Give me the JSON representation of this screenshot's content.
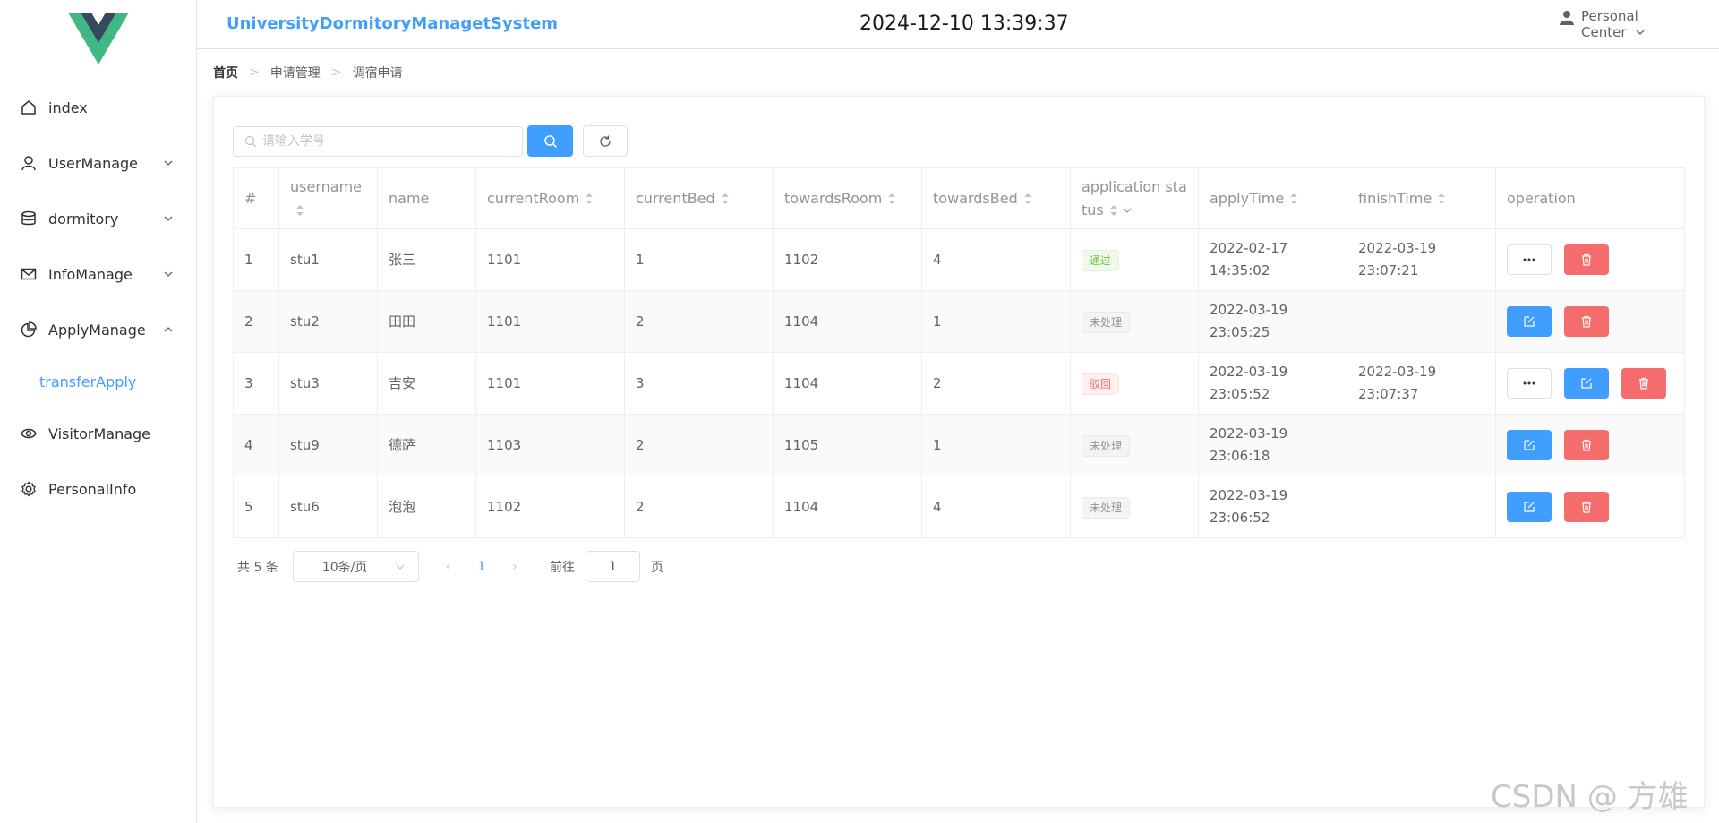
{
  "colors": {
    "accent": "#409eff",
    "danger": "#f56c6c",
    "success": "#67c23a",
    "logo_outer": "#41b883",
    "logo_inner": "#35495e"
  },
  "sidebar": {
    "logo_icon": "vue-logo",
    "items": [
      {
        "label": "index",
        "icon": "home-icon"
      },
      {
        "label": "UserManage",
        "icon": "user-icon",
        "chevron": "down"
      },
      {
        "label": "dormitory",
        "icon": "database-icon",
        "chevron": "down"
      },
      {
        "label": "InfoManage",
        "icon": "mail-icon",
        "chevron": "down"
      },
      {
        "label": "ApplyManage",
        "icon": "pie-chart-icon",
        "chevron": "up"
      },
      {
        "label": "transferApply",
        "sub": true,
        "active": true
      },
      {
        "label": "VisitorManage",
        "icon": "eye-icon"
      },
      {
        "label": "PersonalInfo",
        "icon": "gear-icon"
      }
    ]
  },
  "header": {
    "title": "UniversityDormitoryManagetSystem",
    "datetime": "2024-12-10 13:39:37",
    "user_line1": "Personal",
    "user_line2": "Center"
  },
  "breadcrumb": [
    "首页",
    "申请管理",
    "调宿申请"
  ],
  "search": {
    "placeholder": "请输入学号",
    "value": ""
  },
  "table": {
    "columns": [
      "#",
      "username",
      "name",
      "currentRoom",
      "currentBed",
      "towardsRoom",
      "towardsBed",
      "application status",
      "applyTime",
      "finishTime",
      "operation"
    ],
    "rows": [
      {
        "idx": "1",
        "username": "stu1",
        "name": "张三",
        "currentRoom": "1101",
        "currentBed": "1",
        "towardsRoom": "1102",
        "towardsBed": "4",
        "status": "通过",
        "statusType": "success",
        "applyTime": "2022-02-17 14:35:02",
        "finishTime": "2022-03-19 23:07:21"
      },
      {
        "idx": "2",
        "username": "stu2",
        "name": "田田",
        "currentRoom": "1101",
        "currentBed": "2",
        "towardsRoom": "1104",
        "towardsBed": "1",
        "status": "未处理",
        "statusType": "info",
        "applyTime": "2022-03-19 23:05:25",
        "finishTime": ""
      },
      {
        "idx": "3",
        "username": "stu3",
        "name": "吉安",
        "currentRoom": "1101",
        "currentBed": "3",
        "towardsRoom": "1104",
        "towardsBed": "2",
        "status": "驳回",
        "statusType": "danger",
        "applyTime": "2022-03-19 23:05:52",
        "finishTime": "2022-03-19 23:07:37"
      },
      {
        "idx": "4",
        "username": "stu9",
        "name": "德萨",
        "currentRoom": "1103",
        "currentBed": "2",
        "towardsRoom": "1105",
        "towardsBed": "1",
        "status": "未处理",
        "statusType": "info",
        "applyTime": "2022-03-19 23:06:18",
        "finishTime": ""
      },
      {
        "idx": "5",
        "username": "stu6",
        "name": "泡泡",
        "currentRoom": "1102",
        "currentBed": "2",
        "towardsRoom": "1104",
        "towardsBed": "4",
        "status": "未处理",
        "statusType": "info",
        "applyTime": "2022-03-19 23:06:52",
        "finishTime": ""
      }
    ]
  },
  "pagination": {
    "total_text": "共 5 条",
    "page_size": "10条/页",
    "current_page": "1",
    "goto_label": "前往",
    "goto_value": "1",
    "page_suffix": "页"
  },
  "watermark": "CSDN @ 方雄"
}
